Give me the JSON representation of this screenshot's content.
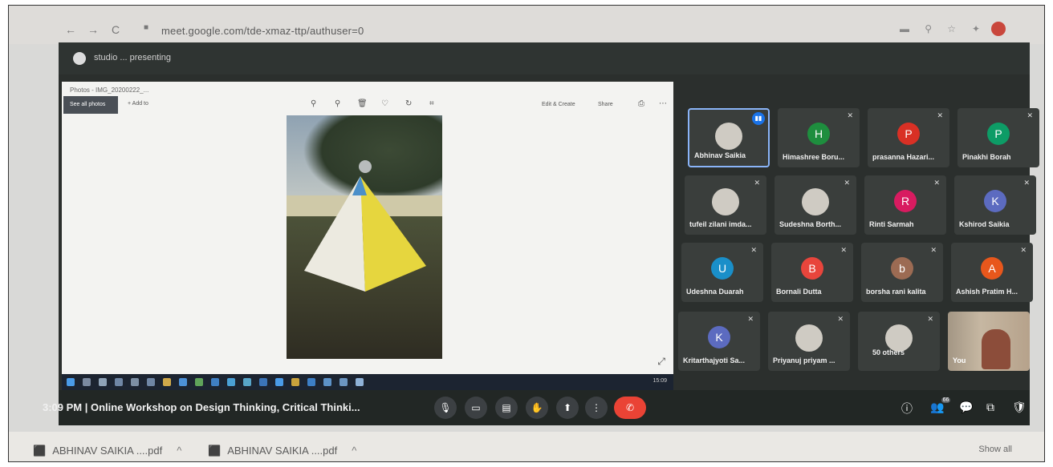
{
  "browser": {
    "url": "meet.google.com/tde-xmaz-ttp/authuser=0",
    "nav": {
      "back": "←",
      "forward": "→",
      "reload": "C"
    }
  },
  "meet": {
    "presenting_label": "studio ... presenting",
    "photos_app": {
      "file_title": "Photos - IMG_20200222_...",
      "see_all_label": "See all photos",
      "add_to_label": "+ Add to",
      "edit_create_label": "Edit & Create",
      "share_label": "Share"
    },
    "taskbar_clock": "15:09",
    "participants": [
      {
        "name": "Abhinav Saikia",
        "avatar": "",
        "color": "#5f6368",
        "active": true,
        "photo": true
      },
      {
        "name": "Himashree Boru...",
        "avatar": "H",
        "color": "#1e8e3e"
      },
      {
        "name": "prasanna Hazari...",
        "avatar": "P",
        "color": "#d93025"
      },
      {
        "name": "Pinakhi Borah",
        "avatar": "P",
        "color": "#0d9c66"
      },
      {
        "name": "tufeil zilani imda...",
        "avatar": "",
        "color": "#cfcbc3",
        "photo": true
      },
      {
        "name": "Sudeshna Borth...",
        "avatar": "",
        "color": "#cfcbc3",
        "photo": true
      },
      {
        "name": "Rinti Sarmah",
        "avatar": "R",
        "color": "#d81b60"
      },
      {
        "name": "Kshirod Saikia",
        "avatar": "K",
        "color": "#5c6bc0"
      },
      {
        "name": "Udeshna Duarah",
        "avatar": "U",
        "color": "#1a8fc9"
      },
      {
        "name": "Bornali Dutta",
        "avatar": "B",
        "color": "#e8453c"
      },
      {
        "name": "borsha rani kalita",
        "avatar": "b",
        "color": "#9c6b53"
      },
      {
        "name": "Ashish Pratim H...",
        "avatar": "A",
        "color": "#e8571c"
      },
      {
        "name": "Kritarthajyoti Sa...",
        "avatar": "K",
        "color": "#5c6bc0"
      },
      {
        "name": "Priyanuj priyam ...",
        "avatar": "",
        "color": "#cfcbc3",
        "photo": true
      },
      {
        "name": "50 others",
        "avatar": "",
        "color": "#cfcbc3",
        "photo": true
      },
      {
        "name": "You",
        "avatar": "",
        "color": "",
        "self": true
      }
    ],
    "bottom": {
      "meeting_info": "3:09 PM  |  Online Workshop on Design Thinking, Critical Thinki...",
      "people_count": "66"
    }
  },
  "downloads": {
    "items": [
      "ABHINAV SAIKIA ....pdf",
      "ABHINAV SAIKIA ....pdf"
    ],
    "show_all": "Show all"
  }
}
